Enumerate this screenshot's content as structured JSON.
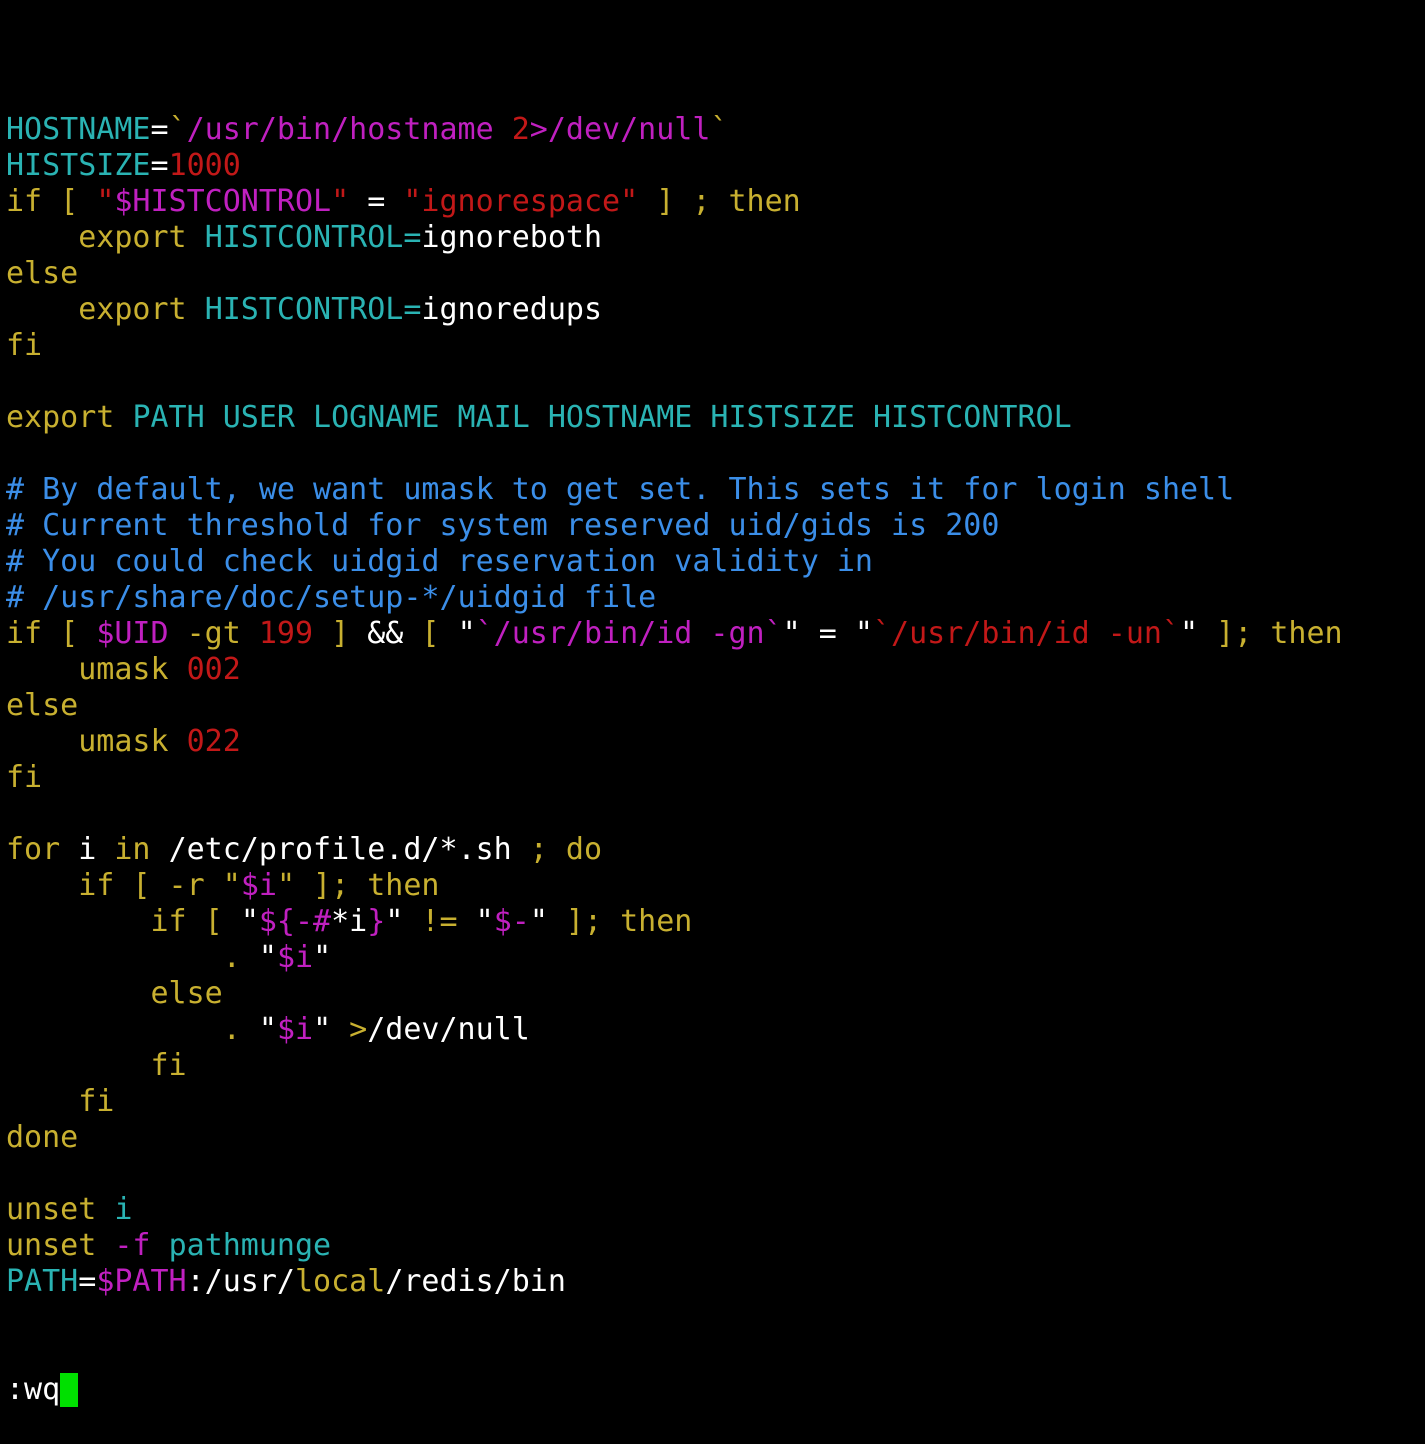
{
  "colors": {
    "background": "#000000",
    "cyan": "#2ab3b3",
    "magenta": "#c020c0",
    "red": "#c21818",
    "yellow": "#c8b030",
    "white": "#ffffff",
    "comment": "#3b8ee8",
    "cursor": "#00e000"
  },
  "editor": {
    "command_line": ":wq",
    "cursor_icon": "block-cursor"
  },
  "lines": [
    [
      {
        "t": "HOSTNAME",
        "c": "cyan"
      },
      {
        "t": "=",
        "c": "white"
      },
      {
        "t": "`",
        "c": "yellow"
      },
      {
        "t": "/usr/bin/hostname ",
        "c": "magenta"
      },
      {
        "t": "2",
        "c": "red"
      },
      {
        "t": ">/dev/null",
        "c": "magenta"
      },
      {
        "t": "`",
        "c": "yellow"
      }
    ],
    [
      {
        "t": "HISTSIZE",
        "c": "cyan"
      },
      {
        "t": "=",
        "c": "white"
      },
      {
        "t": "1000",
        "c": "red"
      }
    ],
    [
      {
        "t": "if [ ",
        "c": "yellow"
      },
      {
        "t": "\"",
        "c": "red"
      },
      {
        "t": "$HISTCONTROL",
        "c": "magenta"
      },
      {
        "t": "\"",
        "c": "red"
      },
      {
        "t": " = ",
        "c": "white"
      },
      {
        "t": "\"ignorespace\"",
        "c": "red"
      },
      {
        "t": " ] ; then",
        "c": "yellow"
      }
    ],
    [
      {
        "t": "    export ",
        "c": "yellow"
      },
      {
        "t": "HISTCONTROL=",
        "c": "cyan"
      },
      {
        "t": "ignoreboth",
        "c": "white"
      }
    ],
    [
      {
        "t": "else",
        "c": "yellow"
      }
    ],
    [
      {
        "t": "    export ",
        "c": "yellow"
      },
      {
        "t": "HISTCONTROL=",
        "c": "cyan"
      },
      {
        "t": "ignoredups",
        "c": "white"
      }
    ],
    [
      {
        "t": "fi",
        "c": "yellow"
      }
    ],
    [],
    [
      {
        "t": "export ",
        "c": "yellow"
      },
      {
        "t": "PATH USER LOGNAME MAIL HOSTNAME HISTSIZE HISTCONTROL",
        "c": "cyan"
      }
    ],
    [],
    [
      {
        "t": "# By default, we want umask to get set. This sets it for login shell",
        "c": "comment"
      }
    ],
    [
      {
        "t": "# Current threshold for system reserved uid/gids is 200",
        "c": "comment"
      }
    ],
    [
      {
        "t": "# You could check uidgid reservation validity in",
        "c": "comment"
      }
    ],
    [
      {
        "t": "# /usr/share/doc/setup-*/uidgid file",
        "c": "comment"
      }
    ],
    [
      {
        "t": "if [ ",
        "c": "yellow"
      },
      {
        "t": "$UID",
        "c": "magenta"
      },
      {
        "t": " -gt ",
        "c": "yellow"
      },
      {
        "t": "199",
        "c": "red"
      },
      {
        "t": " ] ",
        "c": "yellow"
      },
      {
        "t": "&&",
        "c": "white"
      },
      {
        "t": " [ ",
        "c": "yellow"
      },
      {
        "t": "\"",
        "c": "white"
      },
      {
        "t": "`/usr/bin/id -gn`",
        "c": "magenta"
      },
      {
        "t": "\"",
        "c": "white"
      },
      {
        "t": " = ",
        "c": "white"
      },
      {
        "t": "\"",
        "c": "white"
      },
      {
        "t": "`/usr/bin/id -un`",
        "c": "red"
      },
      {
        "t": "\"",
        "c": "white"
      },
      {
        "t": " ]; then",
        "c": "yellow"
      }
    ],
    [
      {
        "t": "    umask ",
        "c": "yellow"
      },
      {
        "t": "002",
        "c": "red"
      }
    ],
    [
      {
        "t": "else",
        "c": "yellow"
      }
    ],
    [
      {
        "t": "    umask ",
        "c": "yellow"
      },
      {
        "t": "022",
        "c": "red"
      }
    ],
    [
      {
        "t": "fi",
        "c": "yellow"
      }
    ],
    [],
    [
      {
        "t": "for ",
        "c": "yellow"
      },
      {
        "t": "i ",
        "c": "white"
      },
      {
        "t": "in ",
        "c": "yellow"
      },
      {
        "t": "/etc/profile.d/*.sh ",
        "c": "white"
      },
      {
        "t": "; do",
        "c": "yellow"
      }
    ],
    [
      {
        "t": "    if [ -r ",
        "c": "yellow"
      },
      {
        "t": "\"",
        "c": "yellow"
      },
      {
        "t": "$i",
        "c": "magenta"
      },
      {
        "t": "\"",
        "c": "yellow"
      },
      {
        "t": " ]; then",
        "c": "yellow"
      }
    ],
    [
      {
        "t": "        if [ ",
        "c": "yellow"
      },
      {
        "t": "\"",
        "c": "white"
      },
      {
        "t": "${-#",
        "c": "magenta"
      },
      {
        "t": "*i",
        "c": "white"
      },
      {
        "t": "}",
        "c": "magenta"
      },
      {
        "t": "\"",
        "c": "white"
      },
      {
        "t": " != ",
        "c": "yellow"
      },
      {
        "t": "\"",
        "c": "white"
      },
      {
        "t": "$-",
        "c": "magenta"
      },
      {
        "t": "\"",
        "c": "white"
      },
      {
        "t": " ]; then",
        "c": "yellow"
      }
    ],
    [
      {
        "t": "            . ",
        "c": "yellow"
      },
      {
        "t": "\"",
        "c": "white"
      },
      {
        "t": "$i",
        "c": "magenta"
      },
      {
        "t": "\"",
        "c": "white"
      }
    ],
    [
      {
        "t": "        else",
        "c": "yellow"
      }
    ],
    [
      {
        "t": "            . ",
        "c": "yellow"
      },
      {
        "t": "\"",
        "c": "white"
      },
      {
        "t": "$i",
        "c": "magenta"
      },
      {
        "t": "\"",
        "c": "white"
      },
      {
        "t": " >",
        "c": "yellow"
      },
      {
        "t": "/dev/null",
        "c": "white"
      }
    ],
    [
      {
        "t": "        fi",
        "c": "yellow"
      }
    ],
    [
      {
        "t": "    fi",
        "c": "yellow"
      }
    ],
    [
      {
        "t": "done",
        "c": "yellow"
      }
    ],
    [],
    [
      {
        "t": "unset ",
        "c": "yellow"
      },
      {
        "t": "i",
        "c": "cyan"
      }
    ],
    [
      {
        "t": "unset ",
        "c": "yellow"
      },
      {
        "t": "-f ",
        "c": "magenta"
      },
      {
        "t": "pathmunge",
        "c": "cyan"
      }
    ],
    [
      {
        "t": "PATH",
        "c": "cyan"
      },
      {
        "t": "=",
        "c": "white"
      },
      {
        "t": "$PATH",
        "c": "magenta"
      },
      {
        "t": ":/usr/",
        "c": "white"
      },
      {
        "t": "local",
        "c": "yellow"
      },
      {
        "t": "/redis/bin",
        "c": "white"
      }
    ]
  ]
}
